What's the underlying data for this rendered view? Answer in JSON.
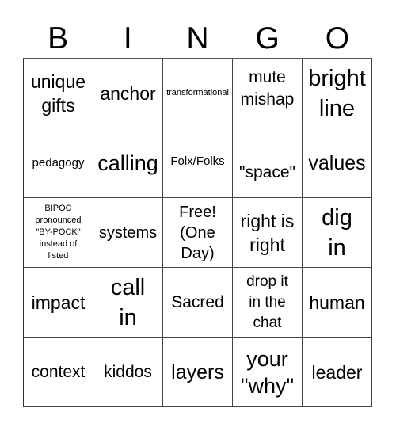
{
  "header": {
    "letters": [
      "B",
      "I",
      "N",
      "G",
      "O"
    ]
  },
  "card": {
    "rows": [
      [
        "unique\ngifts",
        "anchor",
        "transformational",
        "mute\nmishap",
        "bright\nline"
      ],
      [
        "pedagogy",
        "calling",
        "Folx/Folks",
        "\"space\"",
        "values"
      ],
      [
        "BIPOC\npronounced\n\"BY-POCK\"\ninstead of\nlisted",
        "systems",
        "Free!\n(One\nDay)",
        "right is\nright",
        "dig\nin"
      ],
      [
        "impact",
        "call\nin",
        "Sacred",
        "drop it\nin the\nchat",
        "human"
      ],
      [
        "context",
        "kiddos",
        "layers",
        "your\n\"why\"",
        "leader"
      ]
    ]
  },
  "colors": {
    "grid_line": "#444444",
    "text": "#000000",
    "background": "#ffffff"
  }
}
